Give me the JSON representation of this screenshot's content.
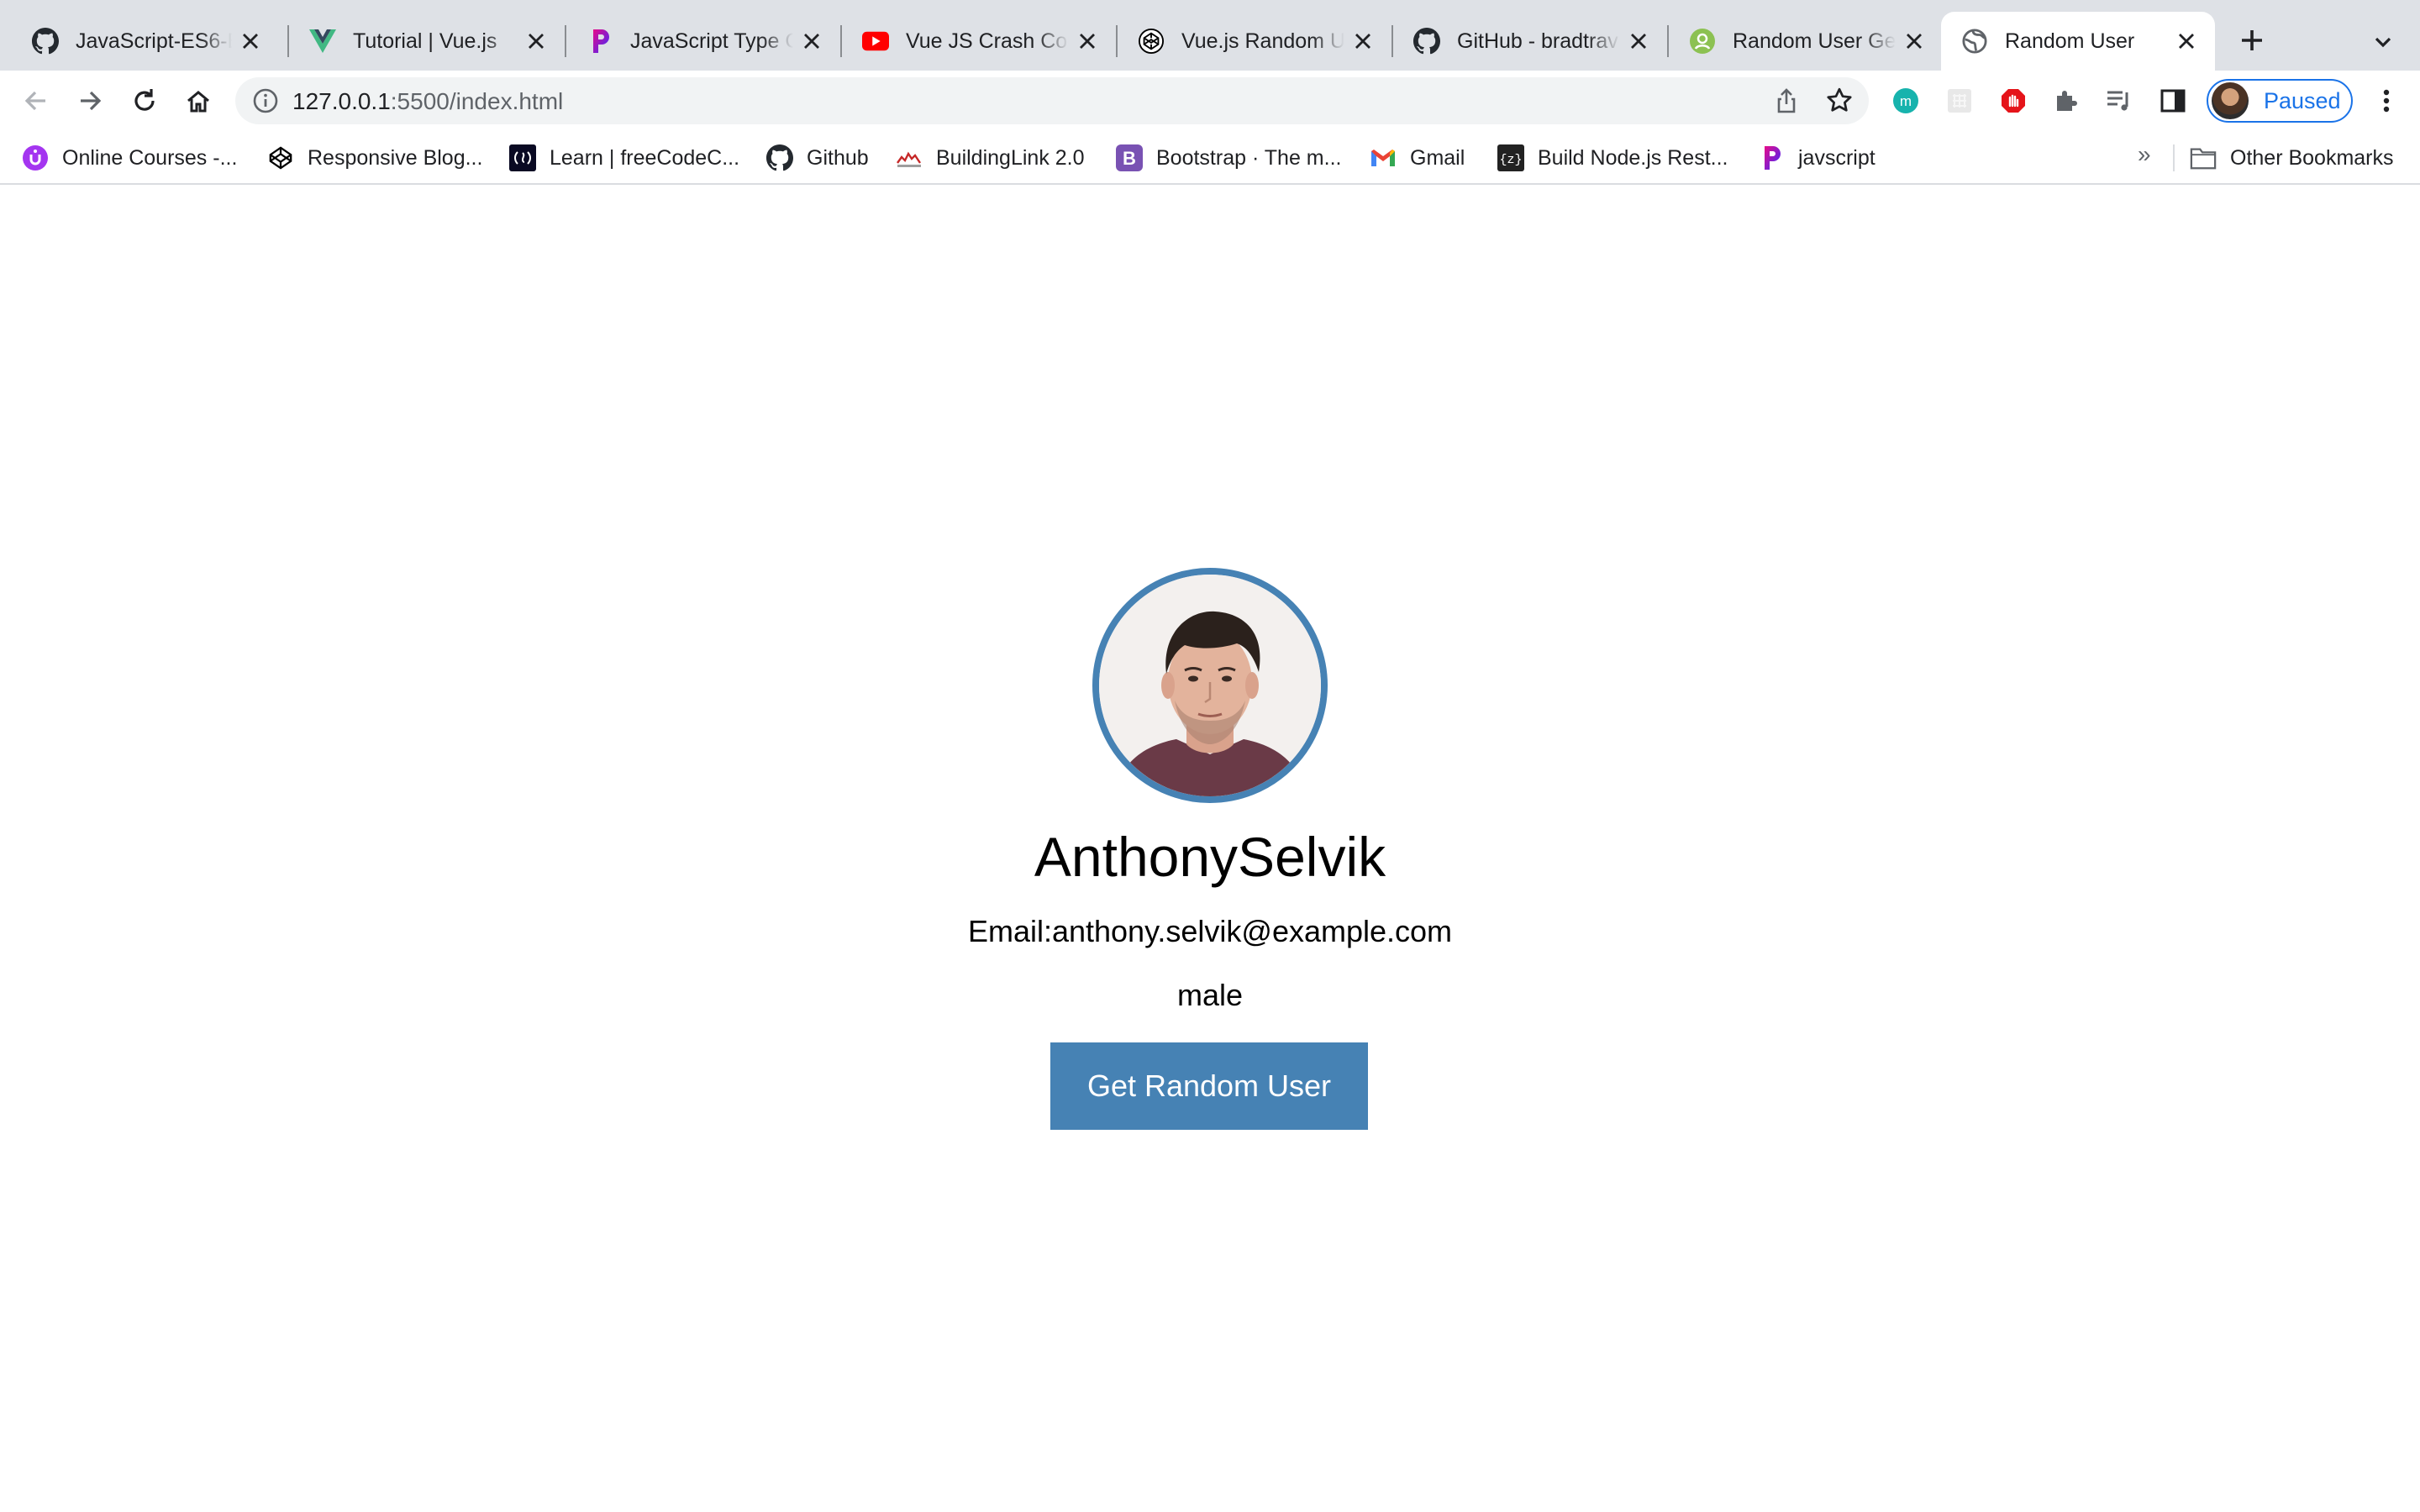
{
  "browser": {
    "tabs": [
      {
        "title": "JavaScript-ES6-B",
        "icon": "github-icon"
      },
      {
        "title": "Tutorial | Vue.js",
        "icon": "vue-icon"
      },
      {
        "title": "JavaScript Type C",
        "icon": "pluralsight-icon"
      },
      {
        "title": "Vue JS Crash Cou",
        "icon": "youtube-icon"
      },
      {
        "title": "Vue.js Random Us",
        "icon": "codepen-icon"
      },
      {
        "title": "GitHub - bradtrav",
        "icon": "github-icon"
      },
      {
        "title": "Random User Ger",
        "icon": "randomuser-icon"
      },
      {
        "title": "Random User",
        "icon": "globe-icon",
        "active": true
      }
    ],
    "address": {
      "host": "127.0.0.1",
      "rest": ":5500/index.html"
    },
    "profile_label": "Paused",
    "bookmarks": [
      {
        "label": "Online Courses -...",
        "icon": "udemy-icon"
      },
      {
        "label": "Responsive Blog...",
        "icon": "codepen-icon"
      },
      {
        "label": "Learn | freeCodeC...",
        "icon": "freecodecamp-icon"
      },
      {
        "label": "Github",
        "icon": "github-icon"
      },
      {
        "label": "BuildingLink 2.0",
        "icon": "buildinglink-icon"
      },
      {
        "label": "Bootstrap · The m...",
        "icon": "bootstrap-icon"
      },
      {
        "label": "Gmail",
        "icon": "gmail-icon"
      },
      {
        "label": "Build Node.js Rest...",
        "icon": "zeit-icon"
      },
      {
        "label": "javscript",
        "icon": "pluralsight-icon"
      }
    ],
    "bookmarks_overflow": "»",
    "other_bookmarks": "Other Bookmarks"
  },
  "user": {
    "name": "AnthonySelvik",
    "email_line": "Email:anthony.selvik@example.com",
    "gender": "male",
    "button_label": "Get Random User"
  },
  "colors": {
    "accent": "#4682b4",
    "link_blue": "#1a73e8"
  }
}
